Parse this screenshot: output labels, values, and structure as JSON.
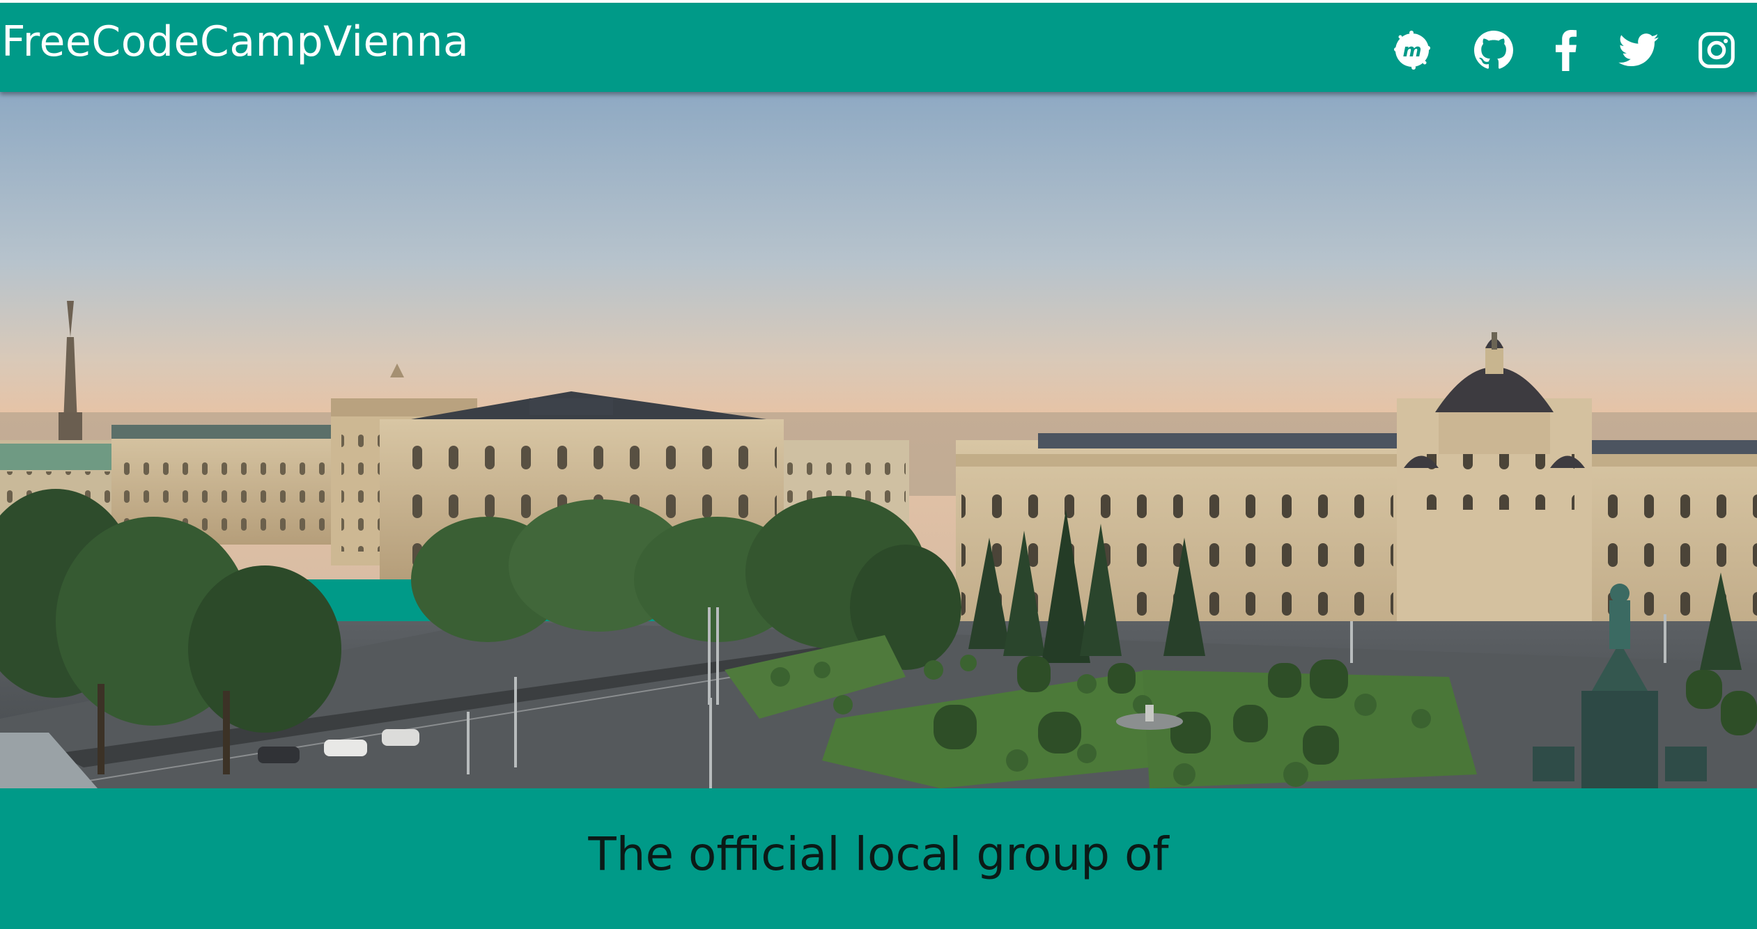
{
  "header": {
    "brand": "FreeCodeCampVienna",
    "social": [
      {
        "name": "meetup",
        "icon": "meetup-icon"
      },
      {
        "name": "github",
        "icon": "github-icon"
      },
      {
        "name": "facebook",
        "icon": "facebook-icon"
      },
      {
        "name": "twitter",
        "icon": "twitter-icon"
      },
      {
        "name": "instagram",
        "icon": "instagram-icon"
      }
    ]
  },
  "hero": {
    "image": "vienna-panorama-museum-quarter"
  },
  "intro": {
    "tagline": "The official local group of"
  },
  "colors": {
    "brand_teal": "#009a88",
    "text_dark": "#0b1a17",
    "white": "#ffffff"
  }
}
